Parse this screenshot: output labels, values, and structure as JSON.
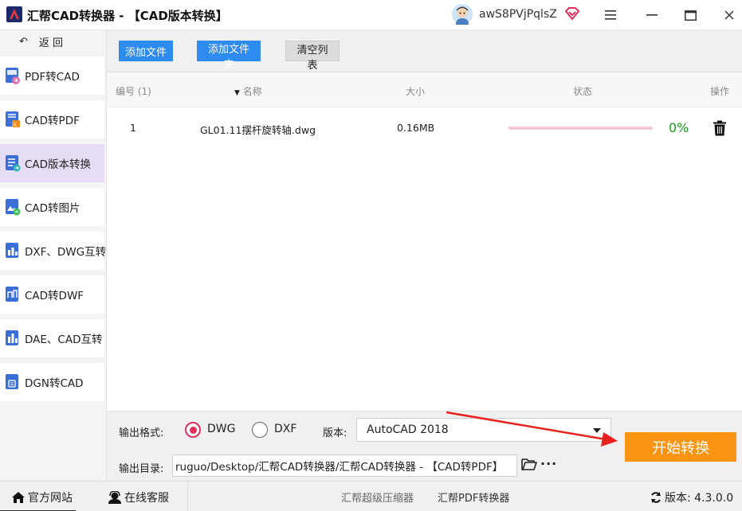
{
  "window": {
    "title": "汇帮CAD转换器 - 【CAD版本转换】",
    "username": "awS8PVjPqlsZ"
  },
  "sidebar": {
    "back_label": "返 回",
    "items": [
      {
        "label": "PDF转CAD",
        "active": false
      },
      {
        "label": "CAD转PDF",
        "active": false
      },
      {
        "label": "CAD版本转换",
        "active": true
      },
      {
        "label": "CAD转图片",
        "active": false
      },
      {
        "label": "DXF、DWG互转",
        "active": false
      },
      {
        "label": "CAD转DWF",
        "active": false
      },
      {
        "label": "DAE、CAD互转",
        "active": false
      },
      {
        "label": "DGN转CAD",
        "active": false
      }
    ]
  },
  "toolbar": {
    "add_file": "添加文件",
    "add_folder": "添加文件夹",
    "clear_list": "清空列表"
  },
  "table": {
    "columns": {
      "index": "编号 (1)",
      "name": "名称",
      "size": "大小",
      "status": "状态",
      "action": "操作"
    },
    "rows": [
      {
        "index": "1",
        "name": "GL01.11摆杆旋转轴.dwg",
        "size": "0.16MB",
        "progress": 0,
        "progress_label": "0%"
      }
    ]
  },
  "settings": {
    "format_label": "输出格式:",
    "format_options": [
      "DWG",
      "DXF"
    ],
    "selected_format": "DWG",
    "version_label": "版本:",
    "version_value": "AutoCAD 2018",
    "output_dir_label": "输出目录:",
    "output_dir_value": "ruguo/Desktop/汇帮CAD转换器/汇帮CAD转换器 - 【CAD转PDF】",
    "more_label": "···",
    "start_button": "开始转换"
  },
  "footer": {
    "website": "官方网站",
    "support": "在线客服",
    "compressor": "汇帮超级压缩器",
    "pdf_converter": "汇帮PDF转换器",
    "version_text": "版本: 4.3.0.0"
  },
  "colors": {
    "accent_blue": "#2e8bef",
    "start_orange": "#fb9412",
    "radio_red": "#e0315c",
    "progress_green": "#1c9b1c",
    "sidebar_active": "#e6ddf5"
  }
}
